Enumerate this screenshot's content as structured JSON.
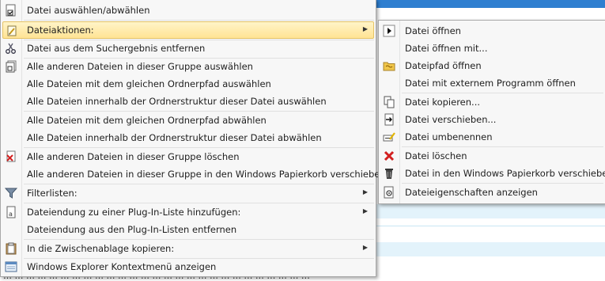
{
  "background": {
    "status_text": "… … … … … … … … … … … … … … … … … … … … … … … … … … …"
  },
  "menu": {
    "items": [
      {
        "label": "Datei auswählen/abwählen",
        "icon": "checkbox-file-icon"
      },
      {
        "label": "Dateiaktionen:",
        "icon": "pencil-file-icon",
        "submenu": true,
        "highlighted": true
      },
      {
        "label": "Datei aus dem Suchergebnis entfernen",
        "icon": "scissors-icon"
      },
      {
        "label": "Alle anderen Dateien in dieser Gruppe auswählen",
        "icon": "checkbox-files-icon"
      },
      {
        "label": "Alle Dateien mit dem gleichen Ordnerpfad auswählen"
      },
      {
        "label": "Alle Dateien innerhalb der Ordnerstruktur dieser Datei auswählen"
      },
      {
        "label": "Alle Dateien mit dem gleichen Ordnerpfad abwählen"
      },
      {
        "label": "Alle Dateien innerhalb der Ordnerstruktur dieser Datei abwählen"
      },
      {
        "label": "Alle anderen Dateien in dieser Gruppe löschen",
        "icon": "delete-files-icon"
      },
      {
        "label": "Alle anderen Dateien in dieser Gruppe in den Windows Papierkorb verschieben"
      },
      {
        "label": "Filterlisten:",
        "icon": "filter-icon",
        "submenu": true
      },
      {
        "label": "Dateiendung zu einer Plug-In-Liste hinzufügen:",
        "icon": "plugin-file-icon",
        "submenu": true
      },
      {
        "label": "Dateiendung aus den Plug-In-Listen entfernen"
      },
      {
        "label": "In die Zwischenablage kopieren:",
        "icon": "clipboard-icon",
        "submenu": true
      },
      {
        "label": "Windows Explorer Kontextmenü anzeigen",
        "icon": "explorer-window-icon"
      }
    ]
  },
  "submenu": {
    "items": [
      {
        "label": "Datei öffnen",
        "icon": "open-arrow-icon"
      },
      {
        "label": "Datei öffnen mit..."
      },
      {
        "label": "Dateipfad öffnen",
        "icon": "folder-icon"
      },
      {
        "label": "Datei mit externem Programm öffnen"
      },
      {
        "label": "Datei kopieren...",
        "icon": "copy-icon"
      },
      {
        "label": "Datei verschieben...",
        "icon": "move-icon"
      },
      {
        "label": "Datei umbenennen",
        "icon": "rename-icon"
      },
      {
        "label": "Datei löschen",
        "icon": "red-x-icon"
      },
      {
        "label": "Datei in den Windows Papierkorb verschieben",
        "icon": "recycle-bin-icon"
      },
      {
        "label": "Dateieigenschaften anzeigen",
        "icon": "properties-icon"
      }
    ]
  },
  "colors": {
    "highlight": "#ffe394",
    "background_band": "#e3f3fb",
    "title_bar": "#2f7fd0"
  }
}
